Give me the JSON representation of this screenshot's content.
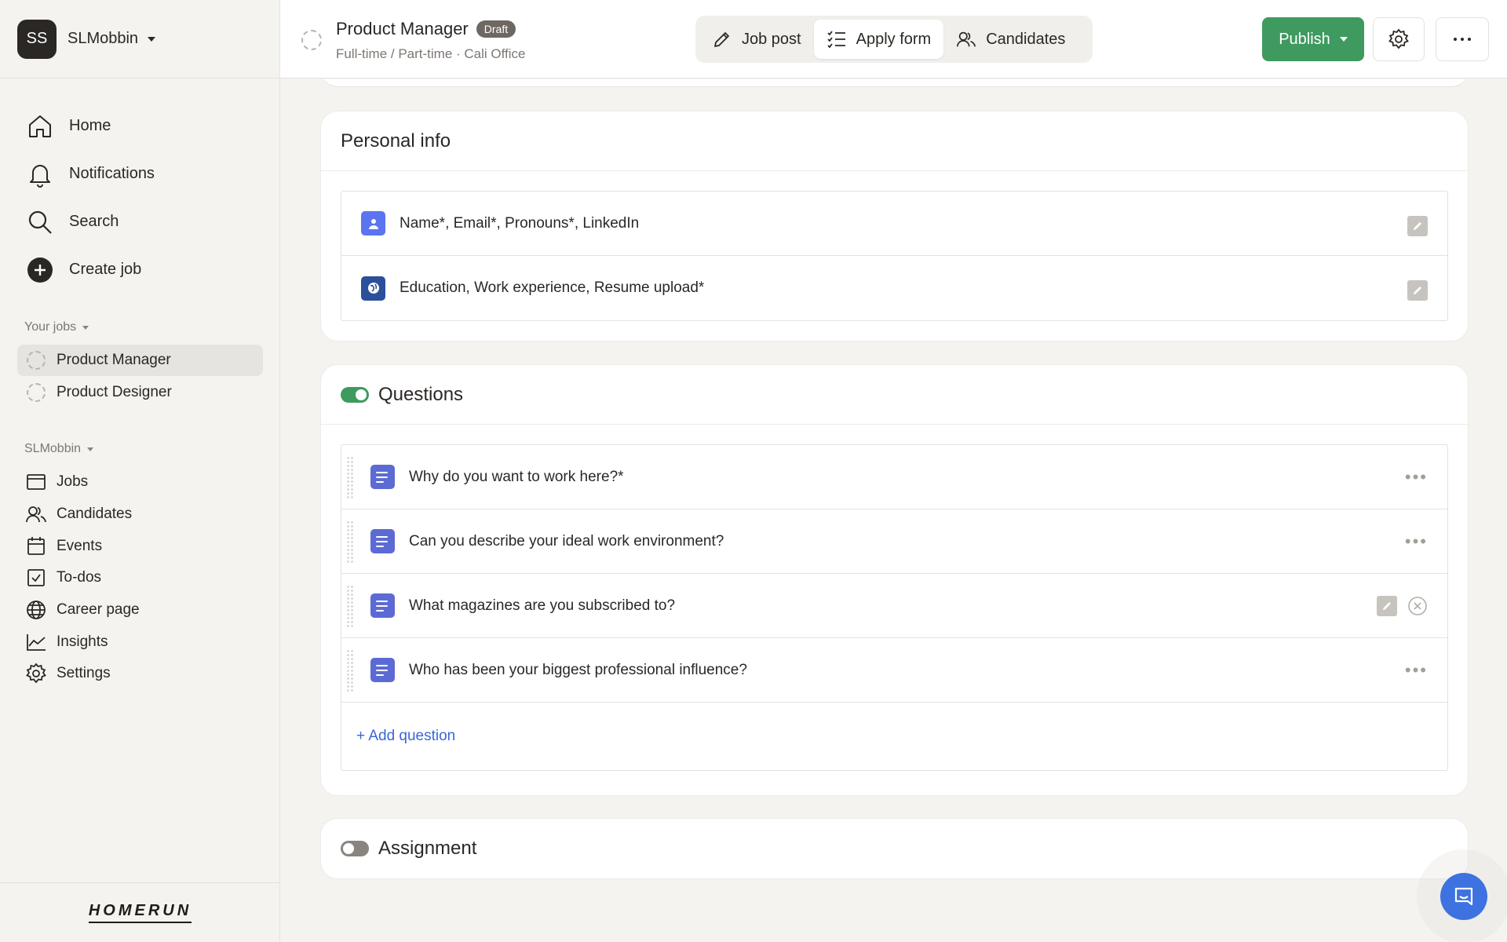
{
  "workspace": {
    "initials": "SS",
    "name": "SLMobbin"
  },
  "main_nav": [
    {
      "label": "Home",
      "icon": "home-icon"
    },
    {
      "label": "Notifications",
      "icon": "bell-icon"
    },
    {
      "label": "Search",
      "icon": "search-icon"
    },
    {
      "label": "Create job",
      "icon": "plus-circle-icon"
    }
  ],
  "jobs_section": {
    "label": "Your jobs",
    "items": [
      {
        "label": "Product Manager",
        "active": true
      },
      {
        "label": "Product Designer",
        "active": false
      }
    ]
  },
  "org_section": {
    "label": "SLMobbin",
    "items": [
      {
        "label": "Jobs",
        "icon": "jobs-icon"
      },
      {
        "label": "Candidates",
        "icon": "candidates-icon"
      },
      {
        "label": "Events",
        "icon": "calendar-icon"
      },
      {
        "label": "To-dos",
        "icon": "checkbox-icon"
      },
      {
        "label": "Career page",
        "icon": "globe-icon"
      },
      {
        "label": "Insights",
        "icon": "chart-icon"
      },
      {
        "label": "Settings",
        "icon": "gear-icon"
      }
    ]
  },
  "logo_text": "HOMERUN",
  "job": {
    "title": "Product Manager",
    "status": "Draft",
    "subtitle": "Full-time / Part-time · Cali Office"
  },
  "tabs": [
    {
      "label": "Job post",
      "icon": "pencil-icon",
      "active": false
    },
    {
      "label": "Apply form",
      "icon": "checklist-icon",
      "active": true
    },
    {
      "label": "Candidates",
      "icon": "candidates-icon",
      "active": false
    }
  ],
  "actions": {
    "publish_label": "Publish"
  },
  "personal_info": {
    "title": "Personal info",
    "rows": [
      {
        "text": "Name*, Email*, Pronouns*, LinkedIn",
        "icon": "person-icon",
        "icon_color": "#5b74f0"
      },
      {
        "text": "Education, Work experience, Resume upload*",
        "icon": "globe-icon",
        "icon_color": "#2b4f9a"
      }
    ]
  },
  "questions": {
    "title": "Questions",
    "enabled": true,
    "items": [
      {
        "text": "Why do you want to work here?*"
      },
      {
        "text": "Can you describe your ideal work environment?"
      },
      {
        "text": "What magazines are you subscribed to?"
      },
      {
        "text": "Who has been your biggest professional influence?"
      }
    ],
    "add_label": "+ Add question"
  },
  "assignment": {
    "title": "Assignment",
    "enabled": false
  },
  "colors": {
    "accent_green": "#3f9a5f",
    "link_blue": "#3a66d6",
    "question_icon": "#5c6bd4",
    "chat_blue": "#3d72e0"
  }
}
